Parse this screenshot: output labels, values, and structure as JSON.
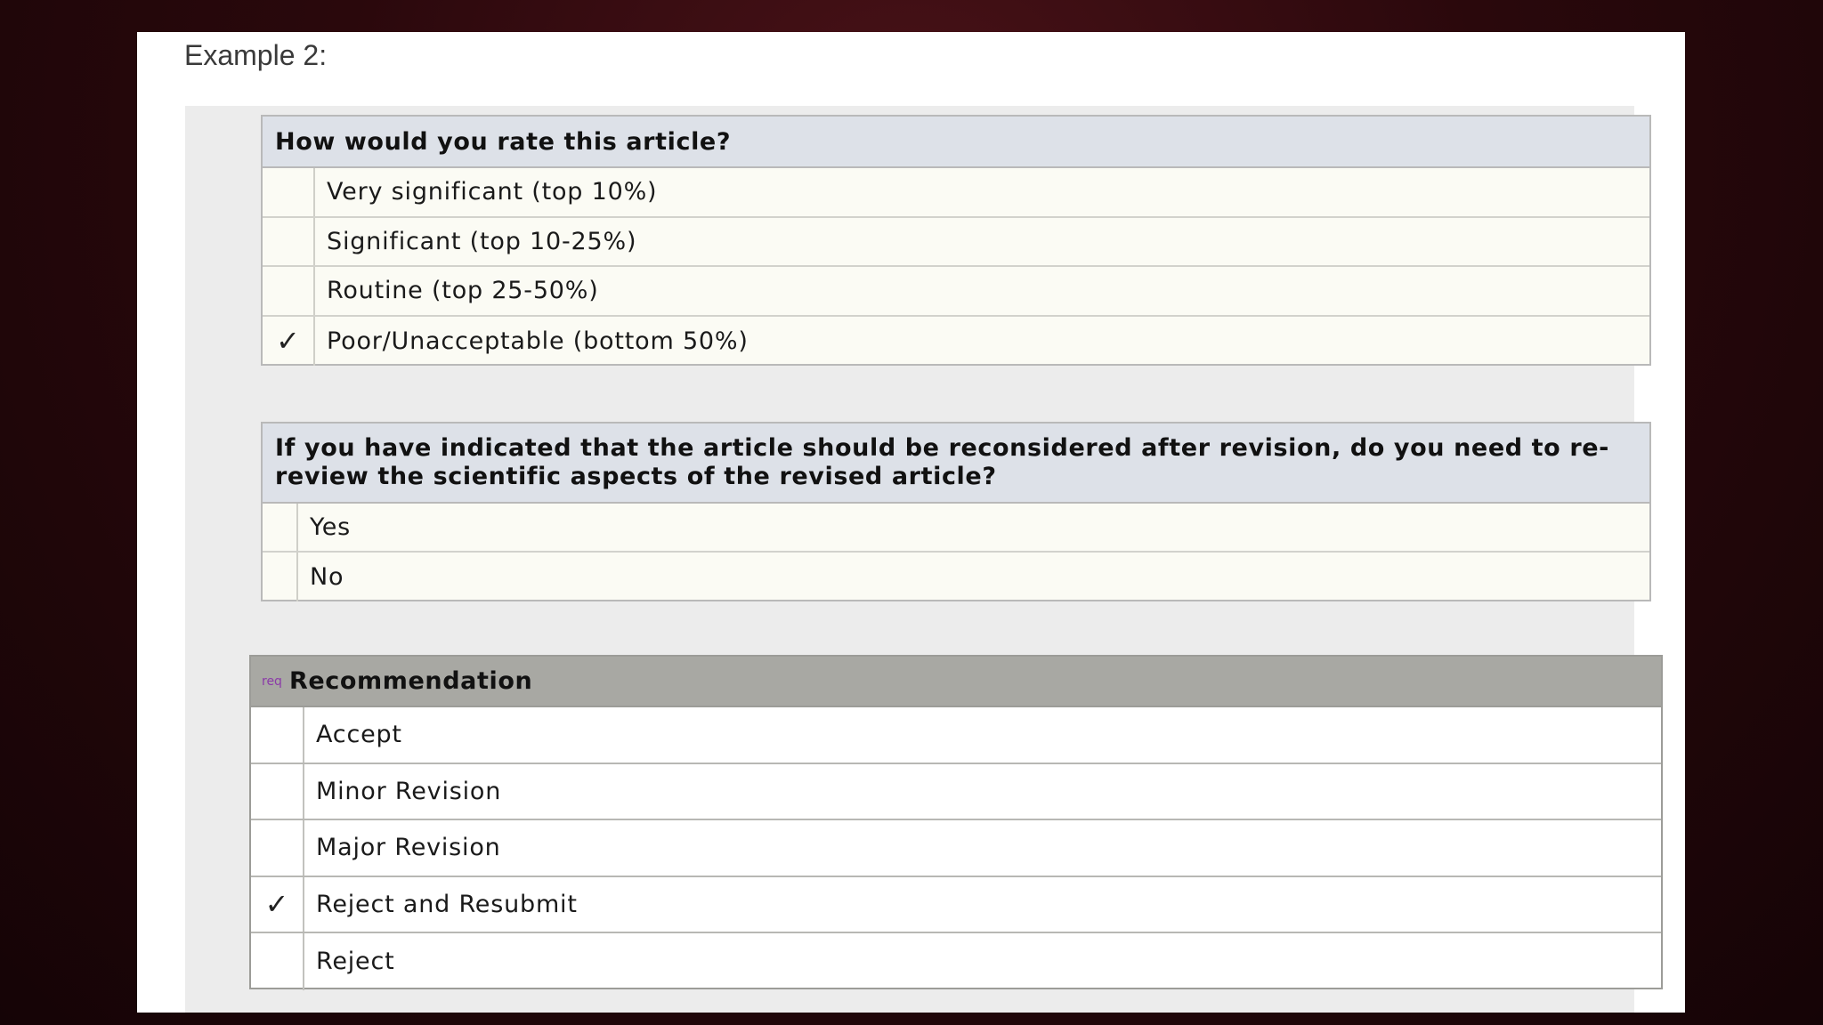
{
  "slide": {
    "title": "Example 2:"
  },
  "rating": {
    "question": "How would you rate this article?",
    "options": [
      {
        "label": "Very significant (top 10%)",
        "checked": false,
        "mark": ""
      },
      {
        "label": "Significant (top 10-25%)",
        "checked": false,
        "mark": ""
      },
      {
        "label": "Routine (top 25-50%)",
        "checked": false,
        "mark": ""
      },
      {
        "label": "Poor/Unacceptable (bottom 50%)",
        "checked": true,
        "mark": "✓"
      }
    ]
  },
  "rereview": {
    "question": "If you have indicated that the article should be reconsidered after revision, do you need to re-review the scientific aspects of the revised article?",
    "options": [
      {
        "label": "Yes",
        "checked": false,
        "mark": ""
      },
      {
        "label": "No",
        "checked": false,
        "mark": ""
      }
    ]
  },
  "recommendation": {
    "req_tag": "req",
    "title": "Recommendation",
    "options": [
      {
        "label": "Accept",
        "checked": false,
        "mark": ""
      },
      {
        "label": "Minor Revision",
        "checked": false,
        "mark": ""
      },
      {
        "label": "Major Revision",
        "checked": false,
        "mark": ""
      },
      {
        "label": "Reject and Resubmit",
        "checked": true,
        "mark": "✓"
      },
      {
        "label": "Reject",
        "checked": false,
        "mark": ""
      }
    ]
  },
  "icons": {
    "check": "check-icon"
  },
  "colors": {
    "header_blue": "#dde1e8",
    "header_gray": "#a8a8a3",
    "row_bg": "#fbfbf4",
    "req_purple": "#8b3aa8"
  }
}
